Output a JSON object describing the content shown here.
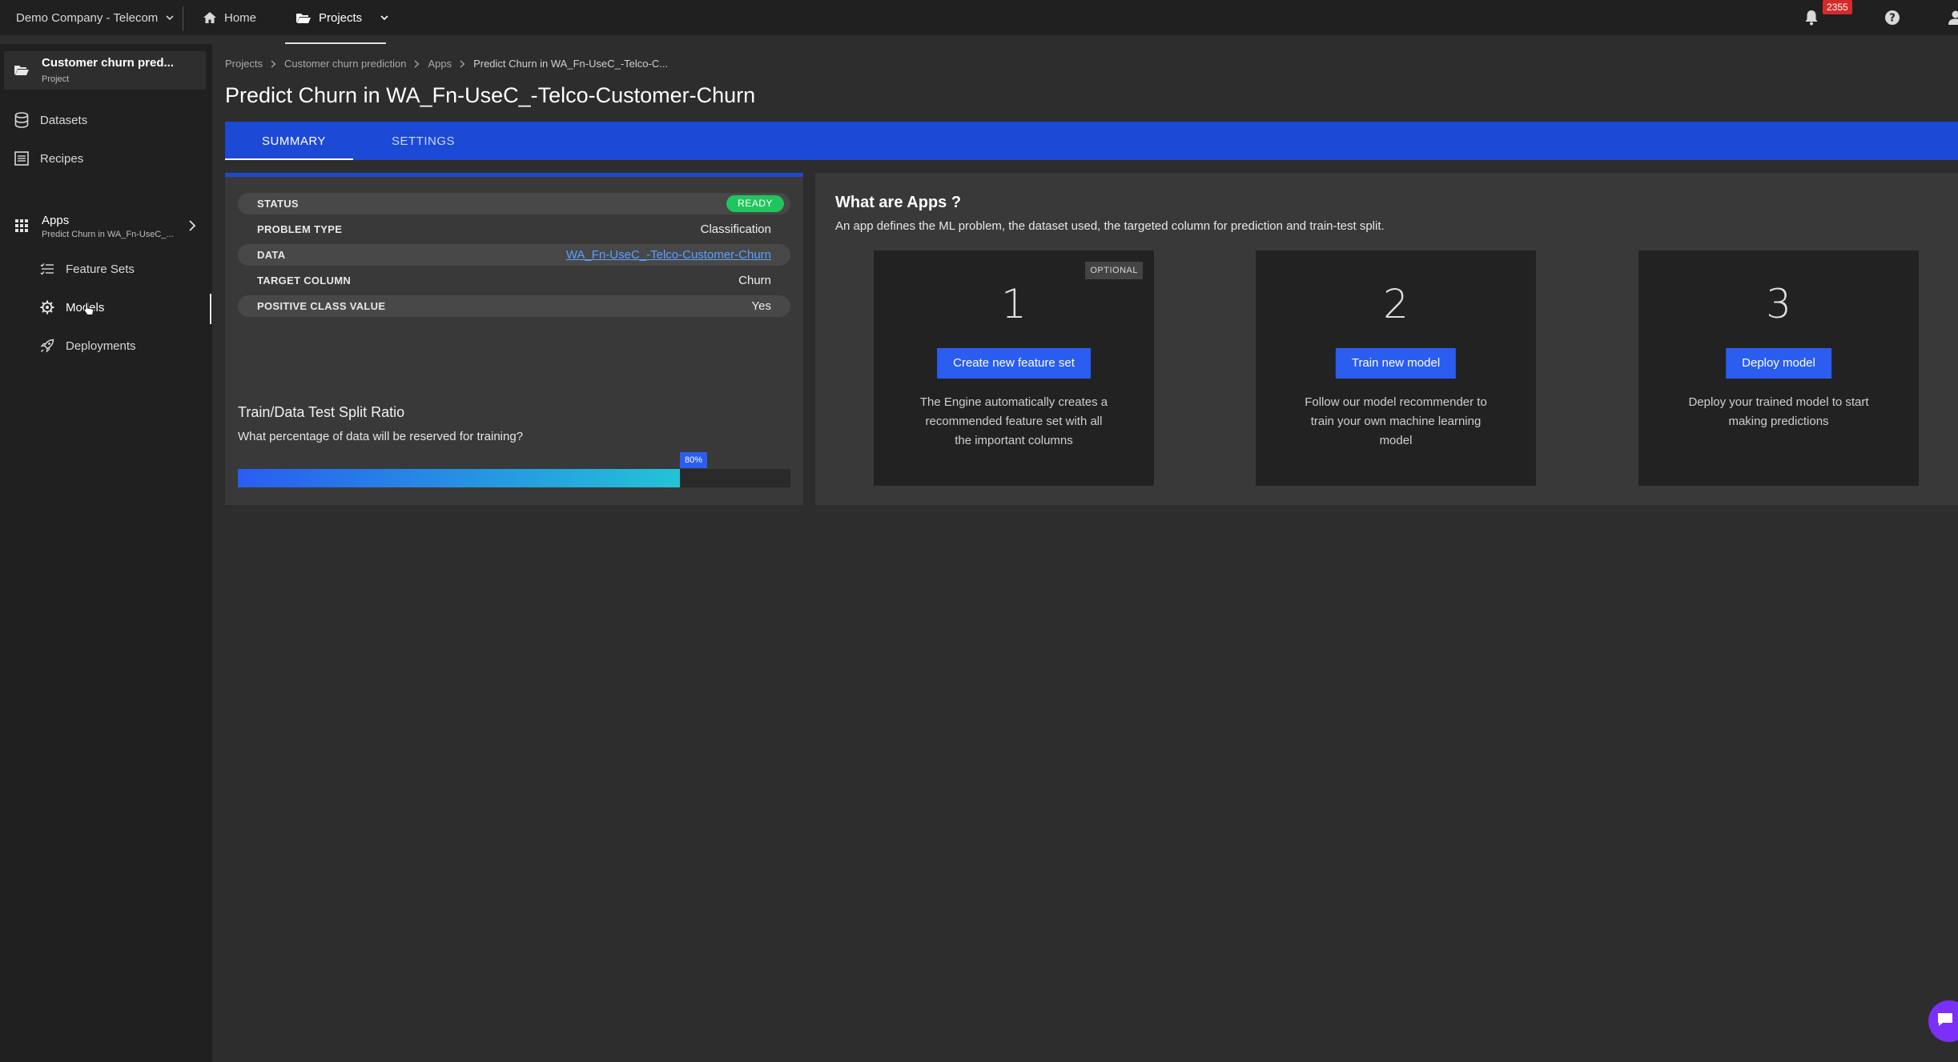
{
  "topbar": {
    "company": "Demo Company - Telecom",
    "home": "Home",
    "projects": "Projects",
    "notification_count": "2355"
  },
  "sidebar": {
    "project_title": "Customer churn pred...",
    "project_sub": "Project",
    "datasets": "Datasets",
    "recipes": "Recipes",
    "apps_title": "Apps",
    "apps_sub": "Predict Churn in WA_Fn-UseC_...",
    "feature_sets": "Feature Sets",
    "models": "Models",
    "deployments": "Deployments"
  },
  "breadcrumb": {
    "b1": "Projects",
    "b2": "Customer churn prediction",
    "b3": "Apps",
    "b4": "Predict Churn in WA_Fn-UseC_-Telco-C..."
  },
  "page": {
    "title": "Predict Churn in WA_Fn-UseC_-Telco-Customer-Churn"
  },
  "tabs": {
    "summary": "SUMMARY",
    "settings": "SETTINGS"
  },
  "summary": {
    "status_label": "STATUS",
    "status_value": "READY",
    "problem_type_label": "PROBLEM TYPE",
    "problem_type_value": "Classification",
    "data_label": "DATA",
    "data_value": "WA_Fn-UseC_-Telco-Customer-Churn",
    "target_label": "TARGET COLUMN",
    "target_value": "Churn",
    "positive_label": "POSITIVE CLASS VALUE",
    "positive_value": "Yes"
  },
  "split": {
    "title": "Train/Data Test Split Ratio",
    "question": "What percentage of data will be reserved for training?",
    "value_label": "80%",
    "value_percent": 80
  },
  "apps_info": {
    "title": "What are Apps ?",
    "description": "An app defines the ML problem, the dataset used, the targeted column for prediction and train-test split.",
    "cards": [
      {
        "num": "1",
        "badge": "OPTIONAL",
        "button": "Create new feature set",
        "desc": "The Engine automatically creates a recommended feature set with all the important columns"
      },
      {
        "num": "2",
        "button": "Train new model",
        "desc": "Follow our model recommender to train your own machine learning model"
      },
      {
        "num": "3",
        "button": "Deploy model",
        "desc": "Deploy your trained model to start making predictions"
      }
    ]
  },
  "colors": {
    "accent_blue": "#1c49d6",
    "button_blue": "#2a5df0",
    "ready_green": "#21c55d",
    "badge_red": "#d42a2a"
  }
}
